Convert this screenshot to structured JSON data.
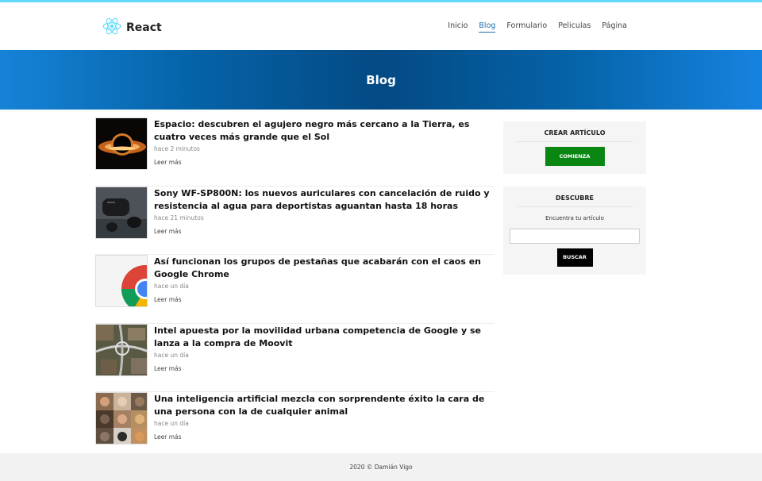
{
  "header": {
    "logo_text": "React",
    "nav": [
      "Inicio",
      "Blog",
      "Formulario",
      "Peliculas",
      "Página"
    ],
    "active_nav": "Blog"
  },
  "hero": {
    "title": "Blog"
  },
  "articles": [
    {
      "title": "Espacio: descubren el agujero negro más cercano a la Tierra, es cuatro veces más grande que el Sol",
      "time": "hace 2 minutos",
      "more": "Leer más",
      "image": "black-hole"
    },
    {
      "title": "Sony WF-SP800N: los nuevos auriculares con cancelación de ruido y resistencia al agua para deportistas aguantan hasta 18 horas",
      "time": "hace 21 minutos",
      "more": "Leer más",
      "image": "earbuds"
    },
    {
      "title": "Así funcionan los grupos de pestañas que acabarán con el caos en Google Chrome",
      "time": "hace un día",
      "more": "Leer más",
      "image": "chrome-logo"
    },
    {
      "title": "Intel apuesta por la movilidad urbana competencia de Google y se lanza a la compra de Moovit",
      "time": "hace un día",
      "more": "Leer más",
      "image": "city-aerial"
    },
    {
      "title": "Una inteligencia artificial mezcla con sorprendente éxito la cara de una persona con la de cualquier animal",
      "time": "hace un día",
      "more": "Leer más",
      "image": "face-grid"
    }
  ],
  "sidebar": {
    "create": {
      "title": "CREAR ARTÍCULO",
      "button": "COMIENZA"
    },
    "search": {
      "title": "DESCUBRE",
      "text": "Encuentra tu artículo",
      "placeholder": "",
      "button": "BUSCAR"
    }
  },
  "footer": {
    "text": "2020 © Damián Vigo"
  },
  "colors": {
    "accent": "#61dafb",
    "link_active": "#1b6fb0",
    "hero_dark": "#044a84",
    "hero_light": "#1683d8",
    "green_button": "#0a8612"
  }
}
